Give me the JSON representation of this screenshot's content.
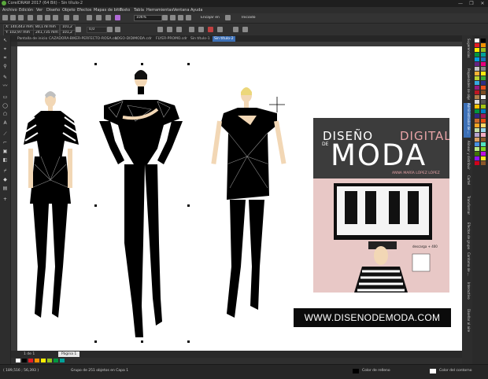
{
  "app": {
    "title": "CorelDRAW 2017 (64 Bit) - Sin título-2",
    "window_controls": [
      "—",
      "❐",
      "✕"
    ]
  },
  "menu": [
    "Archivo",
    "Edición",
    "Ver",
    "Diseño",
    "Objeto",
    "Efectos",
    "Mapas de bits",
    "Texto",
    "Tabla",
    "Herramientas",
    "Ventana",
    "Ayuda"
  ],
  "toolbar": {
    "zoom": "106%",
    "snap_label": "Encajar en",
    "start_label": "Iniciado"
  },
  "propertybar": {
    "x": "X: 140,443 mm",
    "y": "Y: 102,97 mm",
    "w": "80,178 mm",
    "h": "241,735 mm",
    "sx": "101,2",
    "sy": "101,2",
    "angle": "0,0"
  },
  "tabs": [
    {
      "label": "Pantalla de inicio",
      "active": false
    },
    {
      "label": "CAZADORA-BIKER-PERFECTO-ROSA.cdr",
      "active": false
    },
    {
      "label": "LOGO-DIDIMODA.cdr",
      "active": false
    },
    {
      "label": "FLYER-PROMO.cdr",
      "active": false
    },
    {
      "label": "Sin título-1",
      "active": false
    },
    {
      "label": "Sin título-2",
      "active": true
    }
  ],
  "docker_tabs": [
    "Sugerencias",
    "Propiedades de objeto",
    "Administrador de ...",
    "Alinear y distribuir",
    "Cartel",
    "Transformar",
    "Efectos de grupo",
    "Contorno de ...",
    "Interactivo",
    "Diseñar al aire"
  ],
  "canvas": {
    "book": {
      "title_line1": "DISEÑO",
      "title_line1b": "DIGITAL",
      "title_de": "DE",
      "title_line2": "MODA",
      "author": "ANNA MARÍA LÓPEZ LÓPEZ",
      "badge": "descarga + 400"
    },
    "url": "WWW.DISENODEMODA.COM"
  },
  "pagebar": {
    "page_label": "1 de 1",
    "page_tab": "Página 1"
  },
  "status": {
    "coords": "( 189,516 ; 56,393 )",
    "selection": "Grupo de 251 objetos en Capa 1",
    "fill_label": "Color de relleno",
    "outline_label": "Color del contorno"
  },
  "colors": {
    "accent": "#3b6fb6",
    "book_pink": "#e8c8c6",
    "book_dark": "#3c3c3c",
    "skin": "#f2d7b5"
  },
  "palette": [
    "#ffffff",
    "#000000",
    "#e31e24",
    "#f39200",
    "#ffed00",
    "#95c11f",
    "#009640",
    "#00a19a",
    "#009fe3",
    "#1d71b8",
    "#662483",
    "#e6007e",
    "#c6c6c6",
    "#878787",
    "#f9b233",
    "#fcea10",
    "#bcd431",
    "#3aaa35",
    "#36a9e1",
    "#2d2e83",
    "#951b81",
    "#e94e1b",
    "#be1622",
    "#7d4e24",
    "#b17f4a",
    "#f6f6f6",
    "#dadada",
    "#575756",
    "#fdc300",
    "#a3c516",
    "#00963f",
    "#0081c6",
    "#312783",
    "#a2195b",
    "#cb6a2c",
    "#e84e0f",
    "#f5a623",
    "#ffd96a",
    "#c4e0a5",
    "#97d4e9",
    "#b6a3cf",
    "#f2aec4",
    "#d9a066",
    "#8b5a2b",
    "#4a90e2",
    "#50e3c2",
    "#b8e986",
    "#7ed321",
    "#417505",
    "#bd10e0",
    "#9013fe",
    "#f8e71c",
    "#d0021b",
    "#8b572a"
  ]
}
